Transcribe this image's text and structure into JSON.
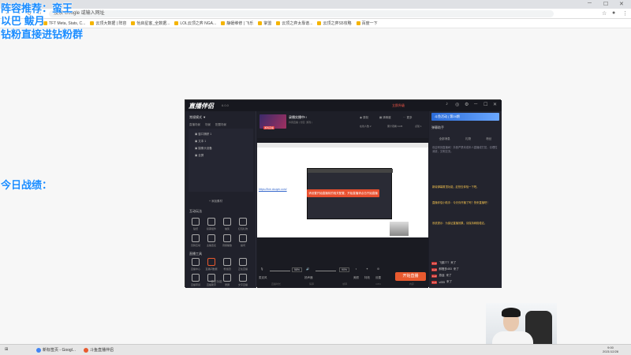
{
  "overlay": {
    "line1": "阵容推荐：蛮王",
    "line2": "以巴 鲅月",
    "line3": "钻粉直接进钻粉群",
    "record": "今日战绩："
  },
  "browser": {
    "address": "搜索 Google 或输入网址",
    "bookmarks": [
      "TFT Meta, Stats, C...",
      "云顶大数据 | 阵容",
      "怡启星客_全数据...",
      "LOL云顶之弈 NGA...",
      "静媛维修 | 飞乐",
      "掌盟",
      "云顶之弈太靠谱...",
      "云顶之弈S5攻略",
      "百度一下"
    ]
  },
  "app": {
    "logo": "直播伴侣",
    "version": "6.0.0",
    "upgrade": "立即升级",
    "left": {
      "header": "常规模式 ▼",
      "tabs": [
        "直播场景",
        "场景",
        "配置场景"
      ],
      "scene_items": [
        "窗口捕获 1",
        "文本 1",
        "摄像头设备",
        "全屏"
      ],
      "add_source": "+ 添加素材",
      "interact_title": "互动玩法",
      "interact_tools": [
        "贴纸",
        "投票组件",
        "抽奖",
        "红包礼物",
        "竞猜互动",
        "主播连麦",
        "音频播放",
        "提问"
      ],
      "live_tools_title": "直播工具",
      "live_tools": [
        "直播中心",
        "直播间数据",
        "粉丝团",
        "正在直播",
        "直播带货",
        "直播助手",
        "录屏",
        "文字直播"
      ],
      "more": "··· 更多功能"
    },
    "mid": {
      "room_name": "录播实播中! !",
      "room_sub": "抖音直播 | 分区: 游戏 |",
      "thumb_caption": "游戏直播",
      "icons": [
        "录制",
        "清晰度",
        "更多"
      ],
      "stats": [
        "在线人数 2",
        "累计观看 1145",
        "点赞 1"
      ],
      "preview_link": "https://live.douyin.com/",
      "toast": "请设置开始直播前的相关配置，开始直播请点击开始直播",
      "labels": [
        "麦克风",
        "扬声器",
        "美颜",
        "特效",
        "设置"
      ],
      "mic_pct": "58%",
      "spk_pct": "90%",
      "start_btn": "开始直播",
      "footer": [
        "直播时长",
        "码率",
        "帧率",
        "CPU",
        "内存"
      ]
    },
    "right": {
      "banner": "斗鱼活动 | 第24期",
      "header": "弹幕助手",
      "tabs": [
        "全部消息",
        "礼物",
        "粉丝"
      ],
      "chat": [
        {
          "text": "欢迎来到直播间！抖音严禁未成年人直播或打赏，请理性消费，文明交流。",
          "color": "#8c8c9a"
        },
        {
          "text": "新增弹幕置顶功能，赶快去体验一下吧。",
          "color": "#f2c14e"
        },
        {
          "text": "直播伴侣小助手：今天你开播了吗？快来直播吧！",
          "color": "#f2c14e"
        },
        {
          "text": "系统提示：为保证直播效果，请保持网络稳定。",
          "color": "#f2c14e"
        }
      ],
      "gifts": [
        {
          "lv": "Lv.2",
          "user": "飞鹤777",
          "action": "来了"
        },
        {
          "lv": "Lv.3",
          "user": "鲜橙多453",
          "action": "来了"
        },
        {
          "lv": "Lv.2",
          "user": "旅途",
          "action": "来了"
        },
        {
          "lv": "Lv.1",
          "user": "v055",
          "action": "来了"
        }
      ]
    }
  },
  "taskbar": {
    "items": [
      "新标签页 - Googl...",
      "斗鱼直播伴侣"
    ],
    "time": "9:00",
    "date": "2021/12/28"
  }
}
